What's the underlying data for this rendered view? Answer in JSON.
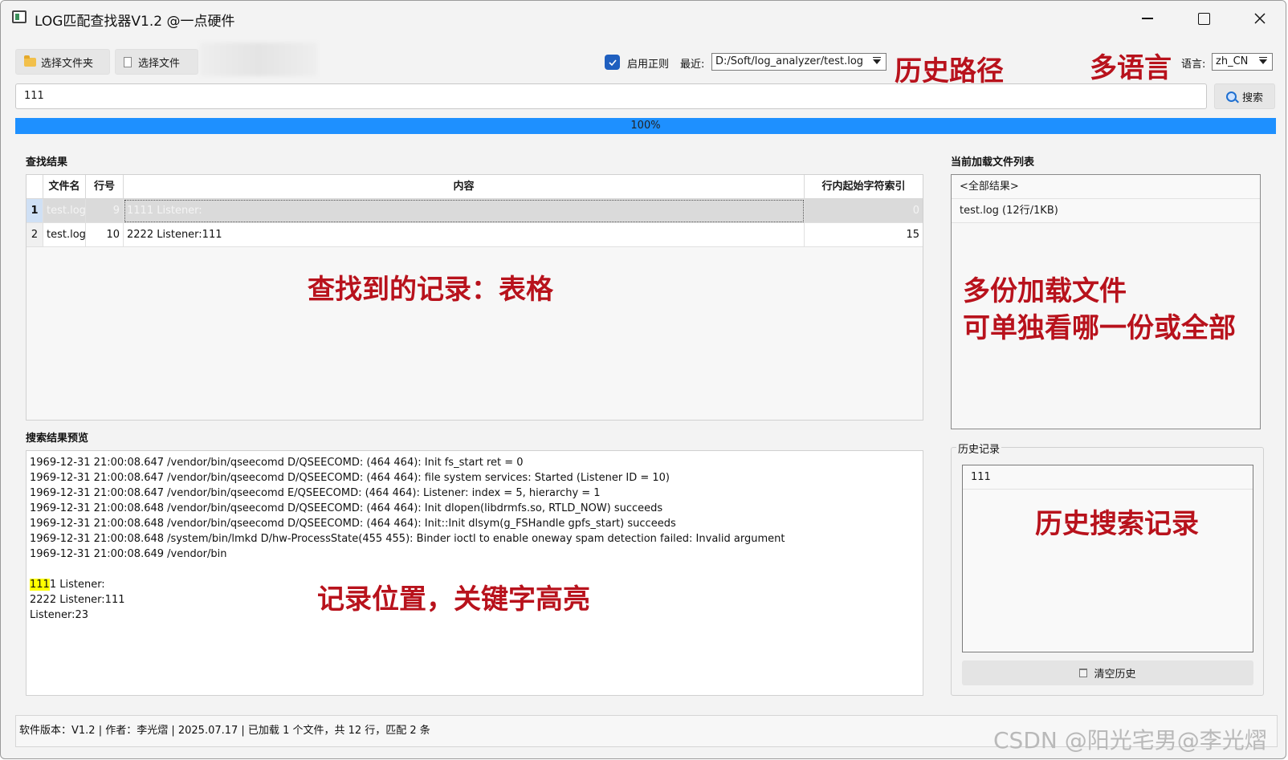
{
  "window": {
    "title": "LOG匹配查找器V1.2 @一点硬件"
  },
  "toolbar": {
    "select_folder": "选择文件夹",
    "select_file": "选择文件",
    "regex_label": "启用正则",
    "regex_checked": true,
    "recent_label": "最近:",
    "recent_value": "D:/Soft/log_analyzer/test.log",
    "lang_label": "语言:",
    "lang_value": "zh_CN"
  },
  "annotations": {
    "history_path": "历史路径",
    "multi_language": "多语言",
    "records_table": "查找到的记录：表格",
    "multi_files_1": "多份加载文件",
    "multi_files_2": "可单独看哪一份或全部",
    "record_position": "记录位置，关键字高亮",
    "history_records": "历史搜索记录"
  },
  "search": {
    "query": "111",
    "button": "搜索"
  },
  "progress": {
    "percent": 100,
    "text": "100%"
  },
  "results": {
    "title": "查找结果",
    "headers": [
      "文件名",
      "行号",
      "内容",
      "行内起始字符索引"
    ],
    "rows": [
      {
        "index": "1",
        "file": "test.log",
        "line": "9",
        "content": "1111  Listener:",
        "start": "0"
      },
      {
        "index": "2",
        "file": "test.log",
        "line": "10",
        "content": "2222  Listener:111",
        "start": "15"
      }
    ]
  },
  "files": {
    "title": "当前加载文件列表",
    "items": [
      "<全部结果>",
      "test.log (12行/1KB)"
    ]
  },
  "preview": {
    "title": "搜索结果预览",
    "lines": [
      "1969-12-31 21:00:08.647 /vendor/bin/qseecomd D/QSEECOMD: (464 464): Init fs_start ret = 0",
      "1969-12-31 21:00:08.647 /vendor/bin/qseecomd D/QSEECOMD: (464 464): file system services: Started (Listener ID = 10)",
      "1969-12-31 21:00:08.647 /vendor/bin/qseecomd E/QSEECOMD: (464 464): Listener: index = 5, hierarchy = 1",
      "1969-12-31 21:00:08.648 /vendor/bin/qseecomd D/QSEECOMD: (464 464): Init dlopen(libdrmfs.so, RTLD_NOW) succeeds",
      "1969-12-31 21:00:08.648 /vendor/bin/qseecomd D/QSEECOMD: (464 464): Init::Init dlsym(g_FSHandle gpfs_start) succeeds",
      "1969-12-31 21:00:08.648 /system/bin/lmkd D/hw-ProcessState(455 455): Binder ioctl to enable oneway spam detection failed: Invalid argument",
      "1969-12-31 21:00:08.649 /vendor/bin"
    ],
    "highlight": "111",
    "highlight_rest": "1  Listener:",
    "after_lines": [
      "2222  Listener:111",
      "Listener:23"
    ],
    "highlight_color": "#ffff00"
  },
  "history": {
    "title": "历史记录",
    "items": [
      "111"
    ],
    "clear_button": "清空历史"
  },
  "status": {
    "text": "软件版本：V1.2  |  作者：李光熠  |  2025.07.17  |  已加载 1 个文件，共 12 行，匹配 2 条"
  },
  "watermark": "CSDN @阳光宅男@李光熠",
  "colors": {
    "accent": "#1e90ff",
    "annotation": "#b8121c",
    "checkbox": "#1f5fbf"
  }
}
